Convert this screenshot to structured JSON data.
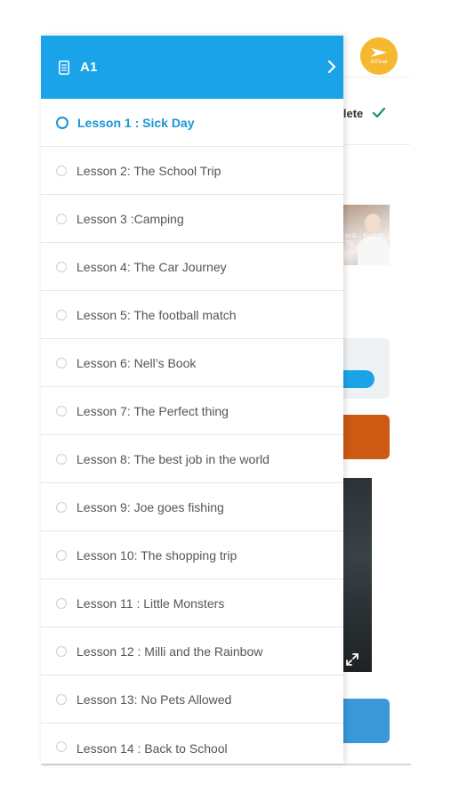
{
  "background": {
    "logo_text": "IXPeak",
    "complete_label": "nplete",
    "thumbnail_caption": "to S... English Tip"
  },
  "drawer": {
    "level_title": "A1",
    "lessons": [
      {
        "label": "Lesson 1 : Sick Day",
        "active": true
      },
      {
        "label": "Lesson 2: The School Trip"
      },
      {
        "label": "Lesson 3 :Camping"
      },
      {
        "label": "Lesson 4: The Car Journey"
      },
      {
        "label": "Lesson 5: The football match"
      },
      {
        "label": "Lesson 6: Nell’s Book"
      },
      {
        "label": "Lesson 7: The Perfect thing"
      },
      {
        "label": "Lesson 8: The best job in the world"
      },
      {
        "label": "Lesson 9: Joe goes fishing"
      },
      {
        "label": "Lesson 10: The shopping trip"
      },
      {
        "label": "Lesson 11 : Little Monsters"
      },
      {
        "label": "Lesson 12 : Milli and the Rainbow"
      },
      {
        "label": "Lesson 13: No Pets Allowed"
      },
      {
        "label": "Lesson 14 : Back to School"
      }
    ]
  },
  "colors": {
    "accent": "#1aa3e8",
    "active_text": "#1a95d4",
    "check": "#1a8f7a",
    "orange": "#cc5a12",
    "logo": "#f5b82e"
  },
  "icons": {
    "header_icon": "document-icon",
    "header_chevron": "chevron-right-icon",
    "complete_icon": "check-icon",
    "video_icon": "expand-icon"
  }
}
